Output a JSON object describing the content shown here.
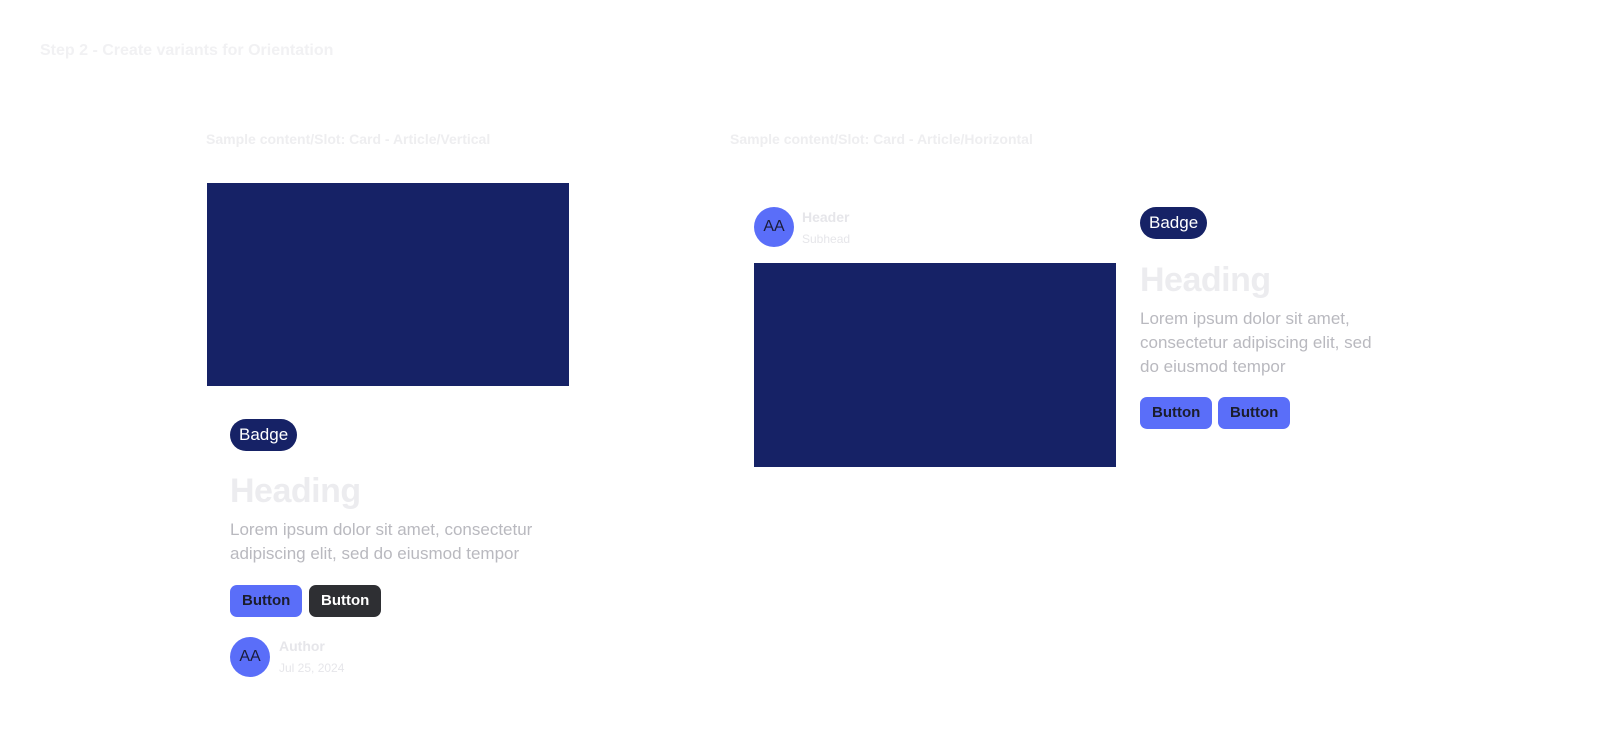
{
  "page": {
    "step_title": "Step 2 - Create variants for Orientation"
  },
  "vertical_card": {
    "frame_label": "Sample content/Slot: Card - Article/Vertical",
    "badge": "Badge",
    "heading": "Heading",
    "body": "Lorem ipsum dolor sit amet, consectetur adipiscing elit, sed do eiusmod tempor",
    "buttons": [
      "Button",
      "Button"
    ],
    "author": {
      "initials": "AA",
      "name": "Author",
      "date": "Jul 25, 2024"
    }
  },
  "horizontal_card": {
    "frame_label": "Sample content/Slot: Card - Article/Horizontal",
    "header": {
      "initials": "AA",
      "title": "Header",
      "subhead": "Subhead"
    },
    "badge": "Badge",
    "heading": "Heading",
    "body": "Lorem ipsum dolor sit amet, consectetur adipiscing elit, sed do eiusmod tempor",
    "buttons": [
      "Button",
      "Button"
    ]
  },
  "colors": {
    "media_fill": "#162266",
    "badge_bg": "#162266",
    "primary_button": "#5a6ef9",
    "dark_button": "#2e2f33",
    "avatar_bg": "#5a6ef9"
  }
}
